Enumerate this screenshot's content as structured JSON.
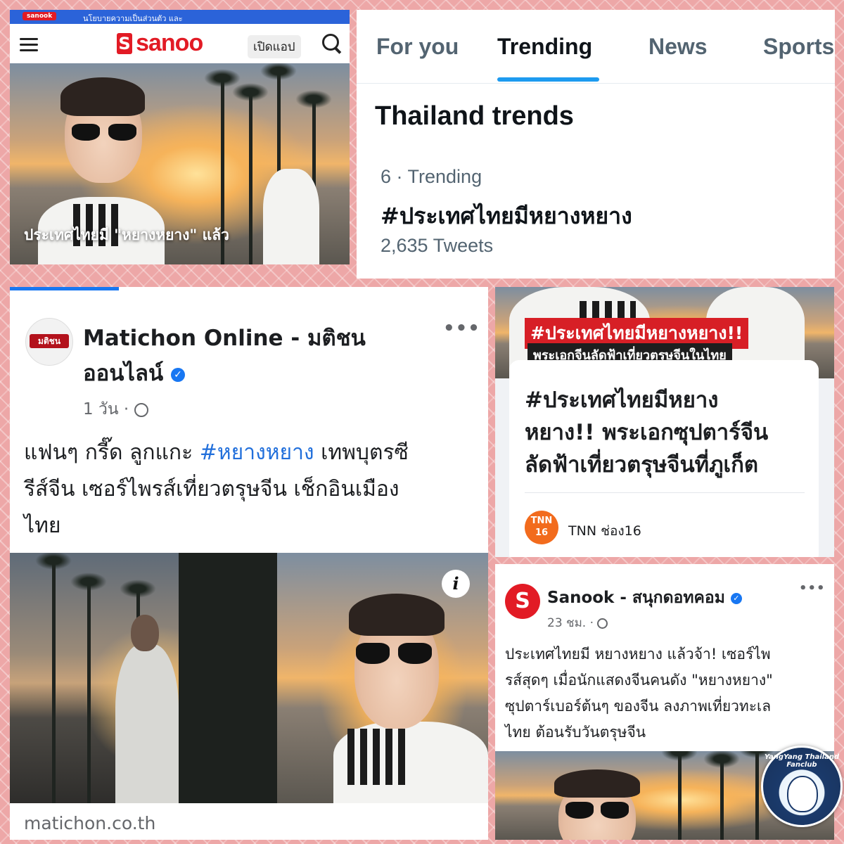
{
  "sanook_app": {
    "top_bar_logo": "sanook",
    "top_bar_text": "นโยบายความเป็นส่วนตัว และ",
    "brand": "sanoo",
    "open_app_label": "เปิดแอป",
    "photo_caption": "ประเทศไทยมี \"หยางหยาง\" แล้ว",
    "icons": [
      "menu-icon",
      "search-icon"
    ]
  },
  "twitter": {
    "tabs": [
      {
        "label": "For you"
      },
      {
        "label": "Trending"
      },
      {
        "label": "News"
      },
      {
        "label": "Sports"
      }
    ],
    "active_tab": "Trending",
    "section_title": "Thailand trends",
    "trend_meta": "6 · Trending",
    "trend_tag": "#ประเทศไทยมีหยางหยาง",
    "trend_count": "2,635 Tweets",
    "accent_color": "#1d9bf0"
  },
  "matichon_post": {
    "avatar_text": "มติชน",
    "page_name_line1": "Matichon Online - มติชน",
    "page_name_line2": "ออนไลน์",
    "time": "1 วัน ·",
    "text_line1_before": "แฟนๆ กรี๊ด ลูกแกะ ",
    "hashtag": "#หยางหยาง",
    "text_line1_after": " เทพบุตรซี",
    "text_line2": "รีส์จีน เซอร์ไพรส์เที่ยวตรุษจีน เช็กอินเมือง",
    "text_line3": "ไทย",
    "link_domain": "matichon.co.th",
    "more_label": "•••",
    "info_label": "i"
  },
  "tnn_post": {
    "banner_line1": "#ประเทศไทยมีหยางหยาง!!",
    "banner_line2": "พระเอกจีนลัดฟ้าเที่ยวตรุษจีนในไทย",
    "headline_line1": "#ประเทศไทยมีหยาง",
    "headline_line2": "หยาง!! พระเอกซุปตาร์จีน",
    "headline_line3": "ลัดฟ้าเที่ยวตรุษจีนที่ภูเก็ต",
    "logo_line1": "TNN",
    "logo_line2": "16",
    "source": "TNN ช่อง16"
  },
  "sanook_post": {
    "avatar_letter": "S",
    "page_name": "Sanook - สนุกดอทคอม",
    "time": "23 ชม. ·",
    "text_line1": "ประเทศไทยมี หยางหยาง แล้วจ้า! เซอร์ไพ",
    "text_line2": "รส์สุดๆ เมื่อนักแสดงจีนคนดัง \"หยางหยาง\"",
    "text_line3": "ซุปตาร์เบอร์ต้นๆ ของจีน ลงภาพเที่ยวทะเล",
    "text_line4": "ไทย ต้อนรับวันตรุษจีน",
    "more_label": "•••"
  },
  "watermark": {
    "text": "YangYang Thailand Fanclub"
  },
  "colors": {
    "background": "#eda7a7",
    "sanook_red": "#e21b25",
    "facebook_blue": "#1877f2",
    "tnn_orange": "#f26b1d"
  }
}
